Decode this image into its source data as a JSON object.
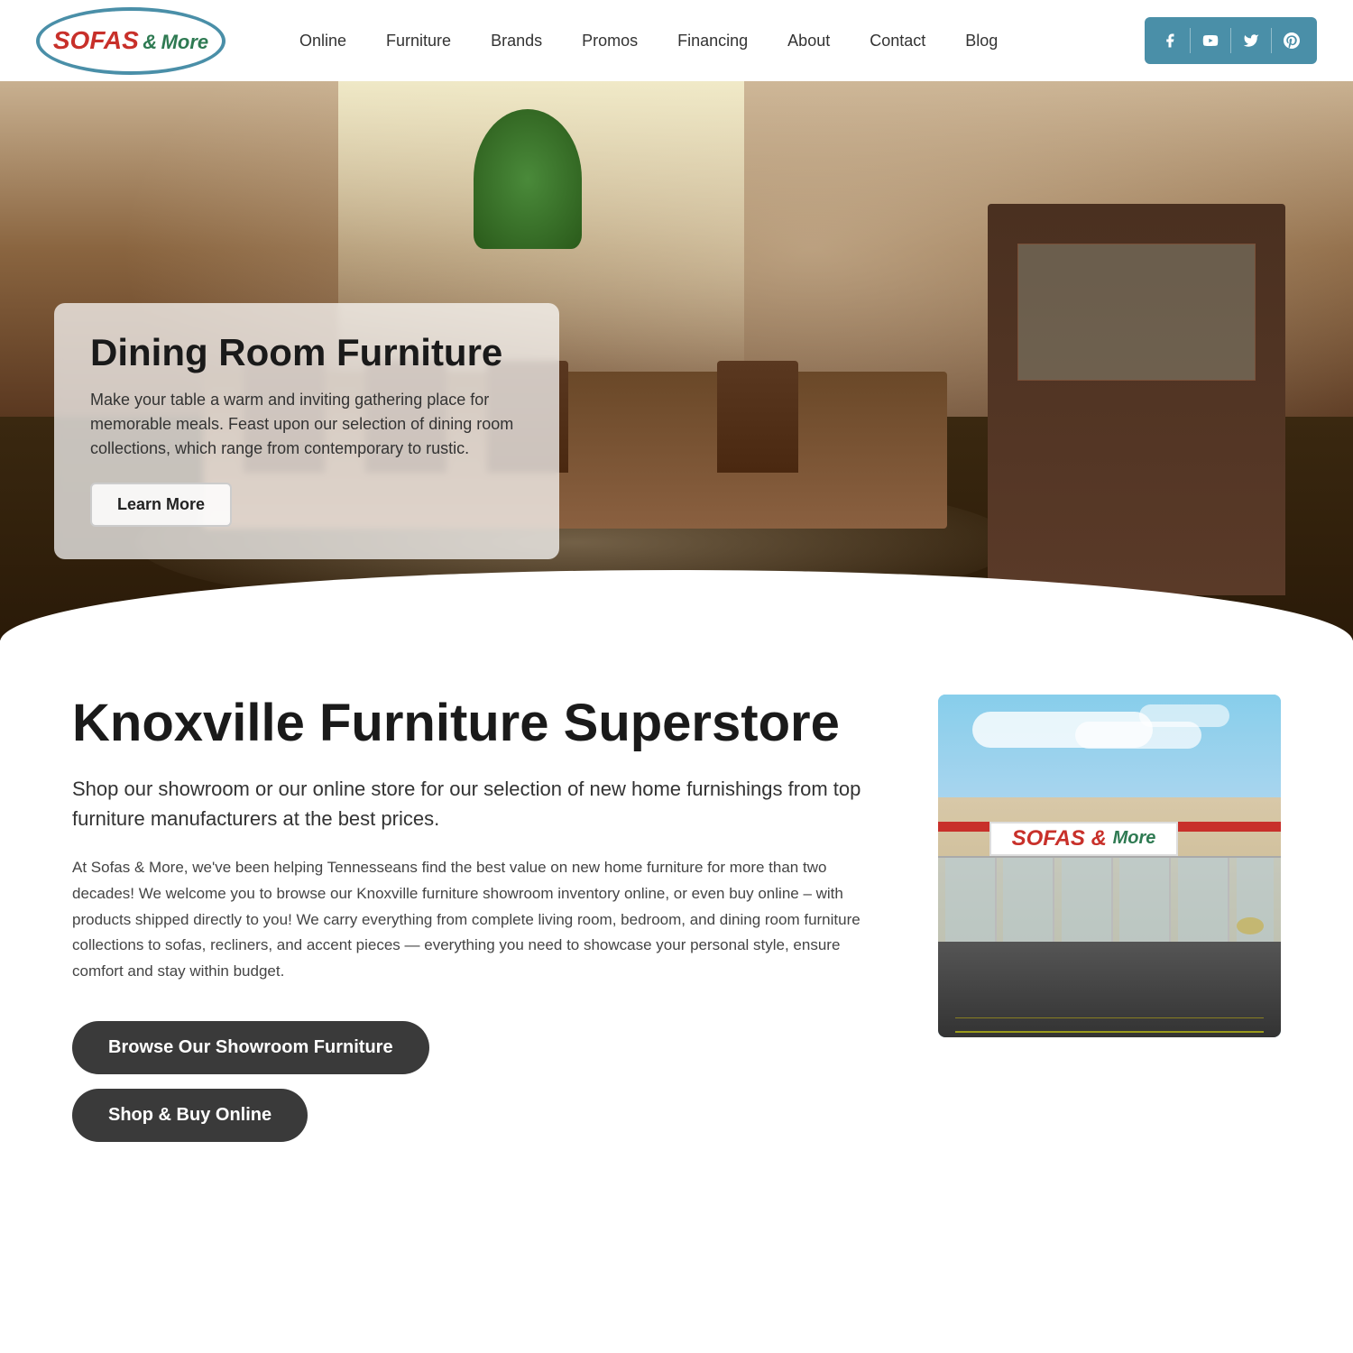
{
  "header": {
    "logo": {
      "brand": "SOFAS",
      "connector": "&",
      "tagline": "More"
    },
    "nav": {
      "items": [
        {
          "label": "Online",
          "id": "nav-online"
        },
        {
          "label": "Furniture",
          "id": "nav-furniture"
        },
        {
          "label": "Brands",
          "id": "nav-brands"
        },
        {
          "label": "Promos",
          "id": "nav-promos"
        },
        {
          "label": "Financing",
          "id": "nav-financing"
        },
        {
          "label": "About",
          "id": "nav-about"
        },
        {
          "label": "Contact",
          "id": "nav-contact"
        },
        {
          "label": "Blog",
          "id": "nav-blog"
        }
      ]
    },
    "social": {
      "facebook": "f",
      "youtube": "▶",
      "twitter": "𝕏",
      "pinterest": "P"
    }
  },
  "hero": {
    "title": "Dining Room Furniture",
    "description": "Make your table a warm and inviting gathering place for memorable meals. Feast upon our selection of dining room collections, which range from contemporary to rustic.",
    "cta": "Learn More"
  },
  "main": {
    "store_title": "Knoxville Furniture Superstore",
    "store_subtitle": "Shop our showroom or our online store for our selection of new home furnishings from top furniture manufacturers at the best prices.",
    "store_description": "At Sofas & More, we've been helping Tennesseans find the best value on new home furniture for more than two decades! We welcome you to browse our Knoxville furniture showroom inventory online,  or even buy online – with products shipped directly to you! We carry everything from complete living room, bedroom, and dining room furniture collections to sofas, recliners, and accent pieces — everything you need to showcase your personal style, ensure comfort and stay within budget.",
    "btn_browse": "Browse Our Showroom Furniture",
    "btn_shop": "Shop & Buy Online",
    "store_sign_red": "SOFAS",
    "store_sign_connector": " & ",
    "store_sign_green": "More"
  }
}
